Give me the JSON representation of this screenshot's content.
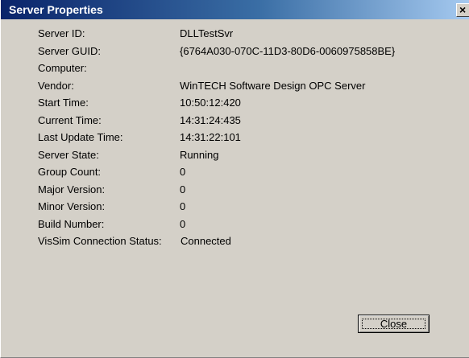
{
  "window": {
    "title": "Server Properties",
    "close_glyph": "×"
  },
  "properties": [
    {
      "label": "Server ID:",
      "value": "DLLTestSvr"
    },
    {
      "label": "Server GUID:",
      "value": "{6764A030-070C-11D3-80D6-0060975858BE}"
    },
    {
      "label": "Computer:",
      "value": ""
    },
    {
      "label": "Vendor:",
      "value": "WinTECH Software Design OPC Server"
    },
    {
      "label": "Start Time:",
      "value": "10:50:12:420"
    },
    {
      "label": "Current Time:",
      "value": "14:31:24:435"
    },
    {
      "label": "Last Update Time:",
      "value": "14:31:22:101"
    },
    {
      "label": "Server State:",
      "value": "Running"
    },
    {
      "label": "Group Count:",
      "value": "0"
    },
    {
      "label": "Major Version:",
      "value": "0"
    },
    {
      "label": "Minor Version:",
      "value": "0"
    },
    {
      "label": "Build Number:",
      "value": "0"
    },
    {
      "label": "VisSim Connection Status:",
      "value": "Connected"
    }
  ],
  "buttons": {
    "close_label": "Close"
  },
  "colors": {
    "titlebar_start": "#0a246a",
    "titlebar_end": "#a6caf0",
    "dialog_face": "#d4d0c8"
  }
}
